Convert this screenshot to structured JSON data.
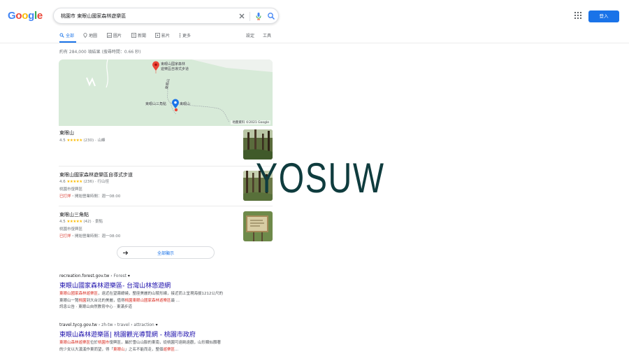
{
  "header": {
    "logo_letters": [
      "G",
      "o",
      "o",
      "g",
      "l",
      "e"
    ],
    "logo_colors": [
      "#4285f4",
      "#ea4335",
      "#fbbc05",
      "#4285f4",
      "#34a853",
      "#ea4335"
    ],
    "query": "桃園市 東眼山國家森林遊樂區",
    "signin_label": "登入"
  },
  "tabs": {
    "items": [
      "全部",
      "地圖",
      "圖片",
      "新聞",
      "影片",
      "更多"
    ],
    "settings": "設定",
    "tools": "工具"
  },
  "result_stats": "約有 284,000 項結果 (搜尋時間：0.66 秒)",
  "map": {
    "pin1_label_1": "東眼山國家森林",
    "pin1_label_2": "遊樂區自導式步道",
    "point_a_label": "東眼山三角點",
    "point_b_label": "東眼山",
    "trail_label": "東眼山",
    "attribution": "地圖資料 ©2021 Google"
  },
  "places": [
    {
      "name": "東眼山",
      "rating": "4.5",
      "stars": "★★★★★",
      "reviews": "(230)",
      "category": "山峰",
      "address": "",
      "status": "",
      "hours": ""
    },
    {
      "name": "東眼山國家森林遊樂區自導式步道",
      "rating": "4.6",
      "stars": "★★★★★",
      "reviews": "(236)",
      "category": "行山徑",
      "address": "桃園市復興區",
      "status": "已打烊",
      "hours": "・開始營業時間：週一08:00"
    },
    {
      "name": "東眼山三角點",
      "rating": "4.5",
      "stars": "★★★★★",
      "reviews": "(42)",
      "category": "景點",
      "address": "桃園市復興區",
      "status": "已打烊",
      "hours": "・開始營業時間：週一08:00"
    }
  ],
  "more_places_label": "全部顯示",
  "results": [
    {
      "url": "recreation.forest.gov.tw",
      "crumb": " › Forest",
      "title": "東眼山國家森林遊樂區- 台灣山林悠遊網",
      "s1_hl": "東眼山國家森林遊樂區",
      "s1_rest": "，遠近在望霧繚繞，整座美麗的山稜形線，接近而上呈現海拔1212公尺的",
      "s2_a": "東眼山一覽",
      "s2_hl1": "桃園",
      "s2_b": "到大台北的美麗，值得",
      "s2_hl2": "桃園東眼山國家森林遊樂區",
      "s2_c": "最 ...",
      "links": "訊息公告 · 東眼山自然教育中心 · 東滿步道"
    },
    {
      "url": "travel.tycg.gov.tw",
      "crumb": " › zh-tw › travel › attraction",
      "title": "東眼山森林遊樂區| 桃園觀光導覽網 - 桃園市政府",
      "s1_hl": "東眼山森林遊樂區",
      "s1_rest": "位於",
      "s1_hl2": "桃園市",
      "s1_rest2": "復興區，屬於雪山山脈的東南，從桃園可遠眺遠觀，山形類似顏著",
      "s2_a": "的少女以大漢溪作東而望，得「",
      "s2_hl1": "東眼山",
      "s2_b": "」之名不能而走，整個",
      "s2_hl2": "遊樂區",
      "s2_c": "..."
    }
  ],
  "watermark": "YOSUW"
}
